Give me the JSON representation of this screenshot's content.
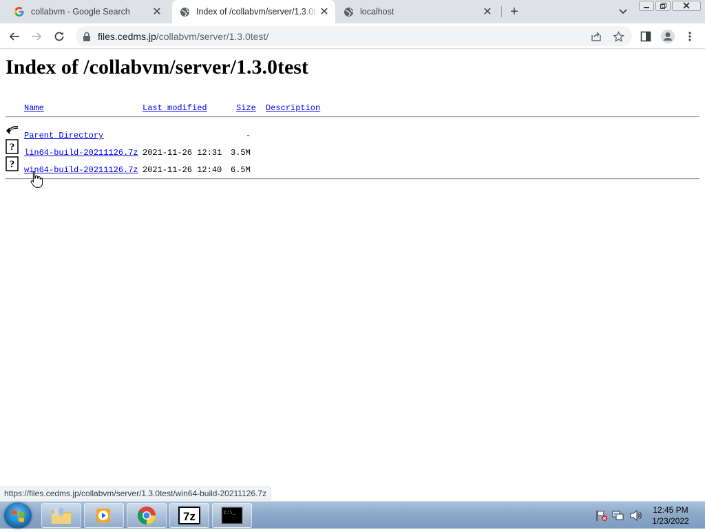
{
  "browser": {
    "tabs": [
      {
        "title": "collabvm - Google Search",
        "favicon": "google-g-icon",
        "active": false
      },
      {
        "title": "Index of /collabvm/server/1.3.0test",
        "favicon": "globe-icon",
        "active": true
      },
      {
        "title": "localhost",
        "favicon": "globe-icon",
        "active": false
      }
    ],
    "close_glyph": "✕",
    "new_tab_glyph": "+",
    "address": {
      "host": "files.cedms.jp",
      "path": "/collabvm/server/1.3.0test/"
    },
    "status_url": "https://files.cedms.jp/collabvm/server/1.3.0test/win64-build-20211126.7z"
  },
  "page": {
    "heading": "Index of /collabvm/server/1.3.0test",
    "columns": {
      "name": "Name",
      "modified": "Last modified",
      "size": "Size",
      "description": "Description"
    },
    "parent": {
      "label": "Parent Directory",
      "size": "-"
    },
    "files": [
      {
        "name": "lin64-build-20211126.7z",
        "modified": "2021-11-26 12:31",
        "size": "3.5M"
      },
      {
        "name": "win64-build-20211126.7z",
        "modified": "2021-11-26 12:40",
        "size": "6.5M"
      }
    ]
  },
  "taskbar": {
    "apps": [
      "windows-explorer",
      "windows-media-player",
      "google-chrome",
      "7-zip",
      "command-prompt"
    ],
    "sevenzip_label": "7z",
    "cmd_label": "C:\\_",
    "time": "12:45 PM",
    "date": "1/23/2022"
  },
  "colors": {
    "link": "#0000ee",
    "tabstrip": "#dee1e6",
    "taskbar": "#8ca9c8"
  }
}
